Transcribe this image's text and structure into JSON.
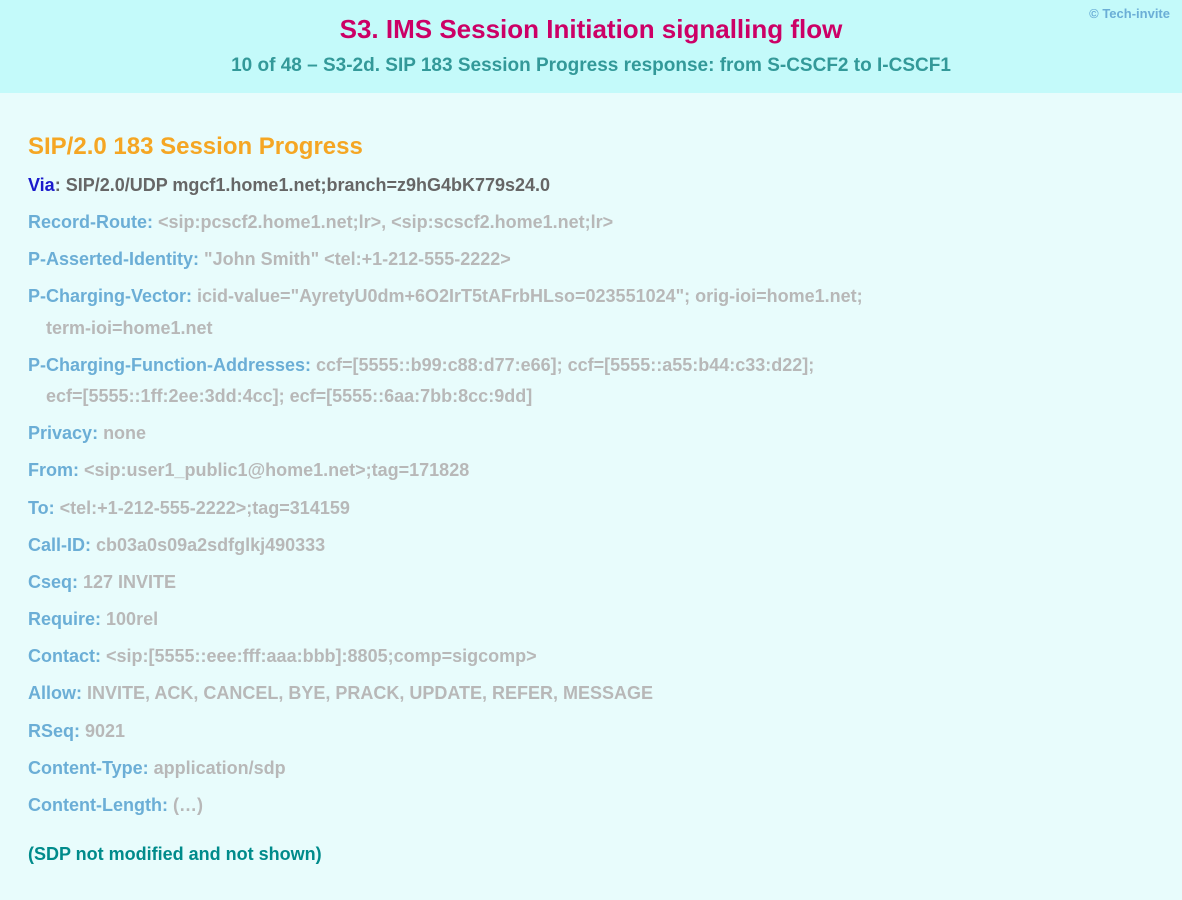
{
  "copyright": "© Tech-invite",
  "header": {
    "title": "S3. IMS Session Initiation signalling flow",
    "subtitle": "10 of 48 – S3-2d. SIP 183 Session Progress response: from S-CSCF2 to I-CSCF1"
  },
  "sip_title": "SIP/2.0 183 Session Progress",
  "via": {
    "key": "Via",
    "value": "SIP/2.0/UDP mgcf1.home1.net;branch=z9hG4bK779s24.0"
  },
  "headers": [
    {
      "key": "Record-Route",
      "value": "<sip:pcscf2.home1.net;lr>, <sip:scscf2.home1.net;lr>"
    },
    {
      "key": "P-Asserted-Identity",
      "value": "\"John Smith\" <tel:+1-212-555-2222>"
    },
    {
      "key": "P-Charging-Vector",
      "value": "icid-value=\"AyretyU0dm+6O2IrT5tAFrbHLso=023551024\"; orig-ioi=home1.net;",
      "cont": "term-ioi=home1.net"
    },
    {
      "key": "P-Charging-Function-Addresses",
      "value": "ccf=[5555::b99:c88:d77:e66]; ccf=[5555::a55:b44:c33:d22];",
      "cont": "ecf=[5555::1ff:2ee:3dd:4cc]; ecf=[5555::6aa:7bb:8cc:9dd]"
    },
    {
      "key": "Privacy",
      "value": "none"
    },
    {
      "key": "From",
      "value": "<sip:user1_public1@home1.net>;tag=171828"
    },
    {
      "key": "To",
      "value": "<tel:+1-212-555-2222>;tag=314159"
    },
    {
      "key": "Call-ID",
      "value": "cb03a0s09a2sdfglkj490333"
    },
    {
      "key": "Cseq",
      "value": "127 INVITE"
    },
    {
      "key": "Require",
      "value": "100rel"
    },
    {
      "key": "Contact",
      "value": "<sip:[5555::eee:fff:aaa:bbb]:8805;comp=sigcomp>"
    },
    {
      "key": "Allow",
      "value": "INVITE, ACK, CANCEL, BYE, PRACK, UPDATE, REFER, MESSAGE"
    },
    {
      "key": "RSeq",
      "value": "9021"
    },
    {
      "key": "Content-Type",
      "value": "application/sdp"
    },
    {
      "key": "Content-Length",
      "value": "(…)"
    }
  ],
  "footer_note": "(SDP not modified and not shown)"
}
